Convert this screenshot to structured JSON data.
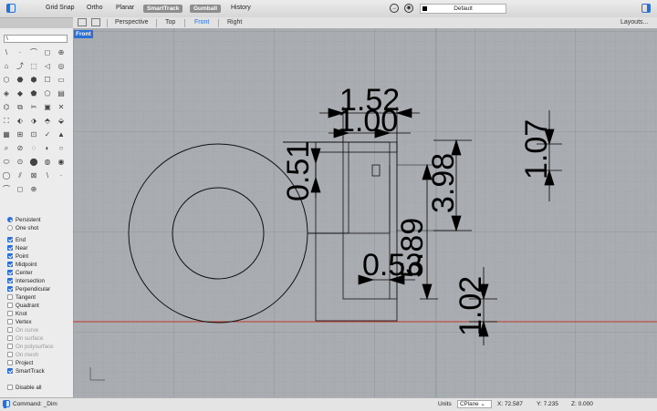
{
  "toolbar": {
    "grid_snap": "Grid Snap",
    "ortho": "Ortho",
    "planar": "Planar",
    "smarttrack": "SmartTrack",
    "gumball": "Gumball",
    "history": "History",
    "layer_name": "Default",
    "layer_color": "#000000"
  },
  "viewport_tabs": {
    "perspective": "Perspective",
    "top": "Top",
    "front": "Front",
    "right": "Right",
    "layouts": "Layouts..."
  },
  "viewport": {
    "label": "Front",
    "dimensions": {
      "d152": "1.52",
      "d100": "1.00",
      "d051": "0.51",
      "d398": "3.98",
      "d107": "1.07",
      "d589": "5.89",
      "d053": "0.53",
      "d102": "1.02"
    }
  },
  "sidebar": {
    "command_input": "\\",
    "osnap_mode": [
      {
        "label": "Persistent",
        "selected": true
      },
      {
        "label": "One shot",
        "selected": false
      }
    ],
    "osnaps": [
      {
        "label": "End",
        "checked": true,
        "disabled": false
      },
      {
        "label": "Near",
        "checked": true,
        "disabled": false
      },
      {
        "label": "Point",
        "checked": true,
        "disabled": false
      },
      {
        "label": "Midpoint",
        "checked": true,
        "disabled": false
      },
      {
        "label": "Center",
        "checked": true,
        "disabled": false
      },
      {
        "label": "Intersection",
        "checked": true,
        "disabled": false
      },
      {
        "label": "Perpendicular",
        "checked": true,
        "disabled": false
      },
      {
        "label": "Tangent",
        "checked": false,
        "disabled": false
      },
      {
        "label": "Quadrant",
        "checked": false,
        "disabled": false
      },
      {
        "label": "Knot",
        "checked": false,
        "disabled": false
      },
      {
        "label": "Vertex",
        "checked": false,
        "disabled": false
      },
      {
        "label": "On curve",
        "checked": false,
        "disabled": true
      },
      {
        "label": "On surface",
        "checked": false,
        "disabled": true
      },
      {
        "label": "On polysurface",
        "checked": false,
        "disabled": true
      },
      {
        "label": "On mesh",
        "checked": false,
        "disabled": true
      },
      {
        "label": "Project",
        "checked": false,
        "disabled": false
      },
      {
        "label": "SmartTrack",
        "checked": true,
        "disabled": false
      }
    ],
    "disable_all": "Disable all"
  },
  "statusbar": {
    "command": "Command: _Dim",
    "units": "Units",
    "cplane": "CPlane",
    "x": "X: 72.587",
    "y": "Y: 7.235",
    "z": "Z: 0.000"
  },
  "colors": {
    "accent": "#2a6fd6",
    "grid_bg": "#a9adb2",
    "axis_x": "#c0392b"
  }
}
